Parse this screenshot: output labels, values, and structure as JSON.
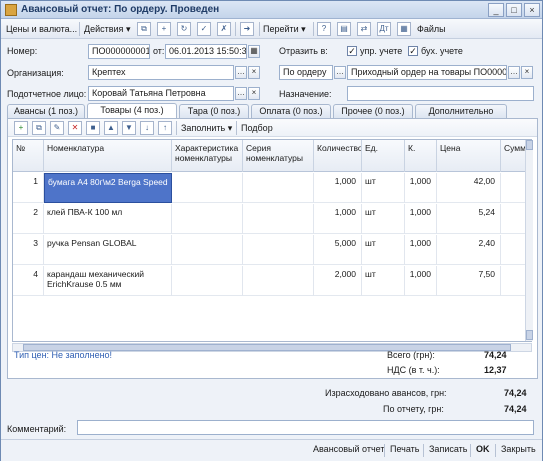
{
  "window": {
    "title": "Авансовый отчет: По ордеру. Проведен"
  },
  "toolbar": {
    "prices_label": "Цены и валюта...",
    "actions_label": "Действия",
    "goto_label": "Перейти",
    "help_label": "?",
    "files_label": "Файлы"
  },
  "header": {
    "number_label": "Номер:",
    "number_value": "ПО000000001",
    "date_from_label": "от:",
    "date_value": "06.01.2013 15:50:35",
    "reflect_label": "Отразить в:",
    "mgmt_label": "упр. учете",
    "acct_label": "бух. учете",
    "org_label": "Организация:",
    "org_value": "Крептех",
    "order_type_value": "По ордеру",
    "order_doc_value": "Приходный ордер на товары ПО0000",
    "person_label": "Подотчетное лицо:",
    "person_value": "Коровай Татьяна Петровна",
    "purpose_label": "Назначение:",
    "purpose_value": ""
  },
  "tabs": [
    {
      "label": "Авансы (1 поз.)"
    },
    {
      "label": "Товары (4 поз.)"
    },
    {
      "label": "Тара (0 поз.)"
    },
    {
      "label": "Оплата (0 поз.)"
    },
    {
      "label": "Прочее (0 поз.)"
    },
    {
      "label": "Дополнительно"
    }
  ],
  "panel_toolbar": {
    "fill_label": "Заполнить",
    "select_label": "Подбор"
  },
  "table": {
    "columns": [
      "№",
      "Номенклатура",
      "Характеристика номенклатуры",
      "Серия номенклатуры",
      "Количество",
      "Ед.",
      "К.",
      "Цена",
      "Сумма"
    ],
    "rows": [
      {
        "n": "1",
        "name": "бумага А4 80г\\м2 Berga Speed",
        "char": "",
        "series": "",
        "qty": "1,000",
        "unit": "шт",
        "k": "1,000",
        "price": "42,00",
        "sum": ""
      },
      {
        "n": "2",
        "name": "клей ПВА-К 100 мл",
        "char": "",
        "series": "",
        "qty": "1,000",
        "unit": "шт",
        "k": "1,000",
        "price": "5,24",
        "sum": ""
      },
      {
        "n": "3",
        "name": "ручка Pensan GLOBAL",
        "char": "",
        "series": "",
        "qty": "5,000",
        "unit": "шт",
        "k": "1,000",
        "price": "2,40",
        "sum": ""
      },
      {
        "n": "4",
        "name": "карандаш механический ErichKrause 0.5 мм",
        "char": "",
        "series": "",
        "qty": "2,000",
        "unit": "шт",
        "k": "1,000",
        "price": "7,50",
        "sum": ""
      }
    ]
  },
  "footer": {
    "price_type_text": "Тип цен: Не заполнено!",
    "total_label": "Всего (грн):",
    "total_value": "74,24",
    "vat_label": "НДС (в т. ч.):",
    "vat_value": "12,37",
    "spent_label": "Израсходовано авансов, грн:",
    "spent_value": "74,24",
    "report_label": "По отчету, грн:",
    "report_value": "74,24",
    "comment_label": "Комментарий:",
    "comment_value": ""
  },
  "bottom_buttons": {
    "report": "Авансовый отчет",
    "print": "Печать",
    "save": "Записать",
    "ok": "OK",
    "close": "Закрыть"
  },
  "colors": {
    "accent": "#4e74c9",
    "warning": "#2f5fb3"
  }
}
